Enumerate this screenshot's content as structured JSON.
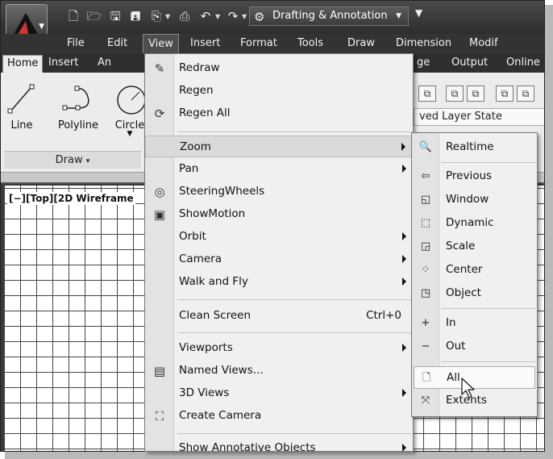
{
  "quick_access": {
    "icons": [
      "new-icon",
      "open-icon",
      "save-icon",
      "save-as-icon",
      "publish-icon",
      "plot-icon",
      "undo-icon",
      "redo-icon"
    ],
    "workspace": "Drafting & Annotation"
  },
  "menubar": {
    "items": [
      "File",
      "Edit",
      "View",
      "Insert",
      "Format",
      "Tools",
      "Draw",
      "Dimension",
      "Modif"
    ],
    "active": "View"
  },
  "ribbon_tabs": {
    "items": [
      "Home",
      "Insert",
      "An",
      "ge",
      "Output",
      "Online"
    ],
    "active": "Home"
  },
  "ribbon": {
    "tools": [
      "Line",
      "Polyline",
      "Circle"
    ],
    "panel_title": "Draw",
    "layer_state": "ved Layer State"
  },
  "viewport_label": "[−][Top][2D Wireframe",
  "view_menu": {
    "items": [
      {
        "label": "Redraw",
        "icon": "redraw-brush-icon"
      },
      {
        "label": "Regen",
        "icon": ""
      },
      {
        "label": "Regen All",
        "icon": "regen-all-icon"
      },
      {
        "label": "Zoom",
        "icon": "",
        "submenu": true,
        "highlighted": true
      },
      {
        "label": "Pan",
        "icon": "",
        "submenu": true
      },
      {
        "label": "SteeringWheels",
        "icon": "steering-wheel-icon"
      },
      {
        "label": "ShowMotion",
        "icon": "showmotion-icon"
      },
      {
        "label": "Orbit",
        "icon": "",
        "submenu": true
      },
      {
        "label": "Camera",
        "icon": "",
        "submenu": true
      },
      {
        "label": "Walk and Fly",
        "icon": "",
        "submenu": true
      },
      {
        "label": "Clean Screen",
        "icon": "",
        "shortcut": "Ctrl+0"
      },
      {
        "label": "Viewports",
        "icon": "",
        "submenu": true
      },
      {
        "label": "Named Views...",
        "icon": "named-views-icon"
      },
      {
        "label": "3D Views",
        "icon": "",
        "submenu": true
      },
      {
        "label": "Create Camera",
        "icon": "create-camera-icon"
      },
      {
        "label": "Show Annotative Objects",
        "icon": "",
        "submenu": true
      }
    ]
  },
  "zoom_menu": {
    "items": [
      {
        "label": "Realtime",
        "icon": "zoom-realtime-icon"
      },
      {
        "label": "Previous",
        "icon": "zoom-previous-icon"
      },
      {
        "label": "Window",
        "icon": "zoom-window-icon"
      },
      {
        "label": "Dynamic",
        "icon": "zoom-dynamic-icon"
      },
      {
        "label": "Scale",
        "icon": "zoom-scale-icon"
      },
      {
        "label": "Center",
        "icon": "zoom-center-icon"
      },
      {
        "label": "Object",
        "icon": "zoom-object-icon"
      },
      {
        "label": "In",
        "icon": "zoom-in-icon"
      },
      {
        "label": "Out",
        "icon": "zoom-out-icon"
      },
      {
        "label": "All",
        "icon": "zoom-all-icon",
        "highlighted": true
      },
      {
        "label": "Extents",
        "icon": "zoom-extents-icon"
      }
    ]
  }
}
